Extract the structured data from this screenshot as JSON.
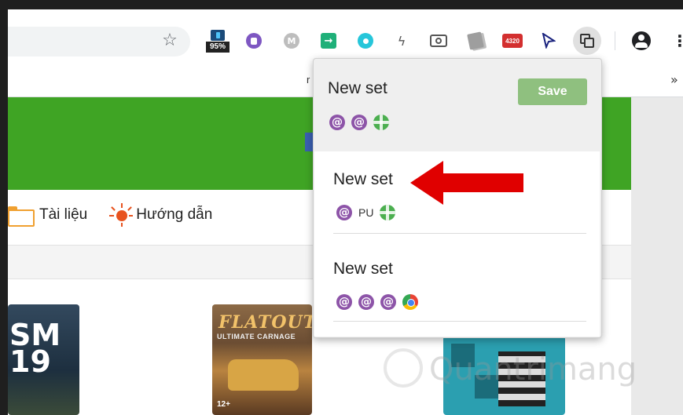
{
  "toolbar": {
    "extensions": [
      {
        "name": "battery-extension",
        "badge": "95%"
      },
      {
        "name": "purple-extension"
      },
      {
        "name": "m-extension",
        "letter": "M"
      },
      {
        "name": "green-arrow-extension"
      },
      {
        "name": "teal-extension"
      },
      {
        "name": "bolt-extension"
      },
      {
        "name": "camera-extension"
      },
      {
        "name": "cards-extension"
      },
      {
        "name": "counter-extension",
        "badge": "4320"
      },
      {
        "name": "cursor-extension"
      },
      {
        "name": "tab-manager-extension"
      }
    ]
  },
  "bookmarks": {
    "partial_item": "r",
    "more": "»"
  },
  "page": {
    "nav": [
      {
        "label": "Tài liệu",
        "icon": "folder-icon"
      },
      {
        "label": "Hướng dẫn",
        "icon": "sun-icon"
      }
    ],
    "games": [
      {
        "title_line1": "SM",
        "title_line2": "19"
      },
      {
        "title": "FLATOUT",
        "subtitle": "ULTIMATE CARNAGE",
        "rating": "12+"
      },
      {
        "title": ""
      }
    ],
    "watermark": "Quantrimang"
  },
  "popup": {
    "current": {
      "title": "New set",
      "save_label": "Save",
      "icons": [
        "at-icon",
        "at-icon",
        "globe-icon"
      ]
    },
    "saved_sets": [
      {
        "title": "New set",
        "icons": [
          "at-icon",
          "pu-text",
          "globe-icon"
        ],
        "pu": "PU"
      },
      {
        "title": "New set",
        "icons": [
          "at-icon",
          "at-icon",
          "at-icon",
          "chrome-icon"
        ]
      }
    ]
  },
  "colors": {
    "green_bar": "#3fa424",
    "save_button": "#8fc07f",
    "arrow": "#e00000",
    "at_icon": "#8d54a8"
  }
}
